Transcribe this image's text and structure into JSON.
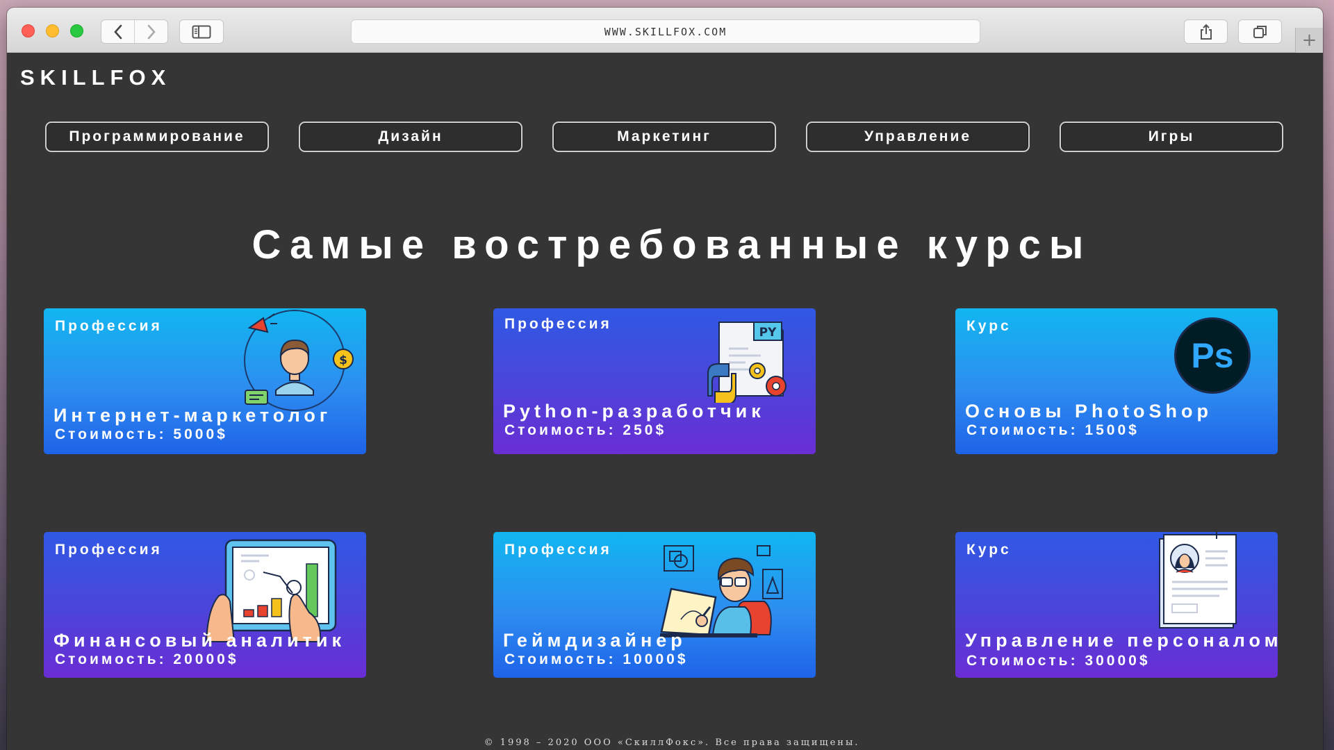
{
  "browser": {
    "url": "WWW.SKILLFOX.COM",
    "back_label": "‹",
    "forward_label": "›",
    "new_tab_label": "+"
  },
  "site": {
    "logo": "SKILLFOX",
    "categories": [
      "Программирование",
      "Дизайн",
      "Маркетинг",
      "Управление",
      "Игры"
    ],
    "heading": "Самые востребованные курсы",
    "cards": [
      {
        "kind": "Профессия",
        "title": "Интернет-маркетолог",
        "price": "Стоимость: 5000$",
        "icon": "marketer-illustration"
      },
      {
        "kind": "Профессия",
        "title": "Python-разработчик",
        "price": "Стоимость: 250$",
        "icon": "python-document-illustration"
      },
      {
        "kind": "Курс",
        "title": "Основы PhotoShop",
        "price": "Стоимость: 1500$",
        "icon": "photoshop-logo",
        "logo_text": "Ps"
      },
      {
        "kind": "Профессия",
        "title": "Финансовый аналитик",
        "price": "Стоимость: 20000$",
        "icon": "tablet-chart-illustration"
      },
      {
        "kind": "Профессия",
        "title": "Геймдизайнер",
        "price": "Стоимость: 10000$",
        "icon": "designer-illustration"
      },
      {
        "kind": "Курс",
        "title": "Управление персоналом",
        "price": "Стоимость: 30000$",
        "icon": "resume-illustration"
      }
    ],
    "footer": "© 1998 – 2020 ООО «СкиллФокс». Все права защищены."
  },
  "colors": {
    "page_bg": "#353535",
    "card_blue_top": "#11b6f0",
    "card_purple_bottom": "#6a2dd4"
  }
}
